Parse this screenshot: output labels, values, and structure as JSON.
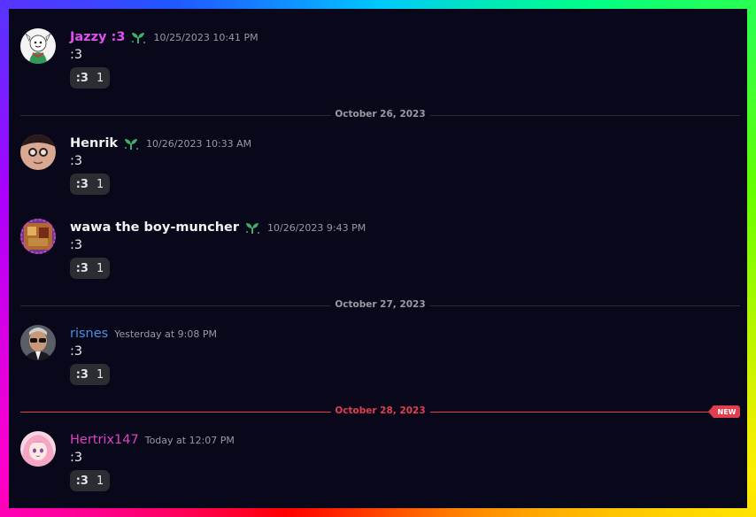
{
  "colors": {
    "background": "#08081a",
    "divider": "#2a2b35",
    "new_marker": "#e23f4e",
    "reaction_bg": "#2c2d33",
    "timestamp": "#9a9aa4"
  },
  "messages": [
    {
      "username": "Jazzy :3",
      "name_color": "#e04ff0",
      "has_badge": true,
      "timestamp": "10/25/2023 10:41 PM",
      "text": ":3",
      "reaction": {
        "emoji": ":3",
        "count": "1"
      },
      "avatar_icon": "goat-avatar-icon"
    },
    {
      "username": "Henrik",
      "name_color": "#f2f2f2",
      "has_badge": true,
      "timestamp": "10/26/2023 10:33 AM",
      "text": ":3",
      "reaction": {
        "emoji": ":3",
        "count": "1"
      },
      "avatar_icon": "face-avatar-icon"
    },
    {
      "username": "wawa the boy-muncher",
      "name_color": "#f2f2f2",
      "has_badge": true,
      "timestamp": "10/26/2023 9:43 PM",
      "text": ":3",
      "reaction": {
        "emoji": ":3",
        "count": "1"
      },
      "avatar_icon": "collage-avatar-icon"
    },
    {
      "username": "risnes",
      "name_color": "#4a90e8",
      "has_badge": false,
      "timestamp": "Yesterday at 9:08 PM",
      "text": ":3",
      "reaction": {
        "emoji": ":3",
        "count": "1"
      },
      "avatar_icon": "sunglasses-man-avatar-icon"
    },
    {
      "username": "Hertrix147",
      "name_color": "#e040c8",
      "has_badge": false,
      "timestamp": "Today at 12:07 PM",
      "text": ":3",
      "reaction": {
        "emoji": ":3",
        "count": "1"
      },
      "avatar_icon": "anime-girl-avatar-icon"
    }
  ],
  "dividers": [
    {
      "label": "October 26, 2023"
    },
    {
      "label": "October 27, 2023"
    },
    {
      "label": "October 28, 2023",
      "is_new": true,
      "new_label": "NEW"
    }
  ],
  "badge_icon": "sprout-icon"
}
